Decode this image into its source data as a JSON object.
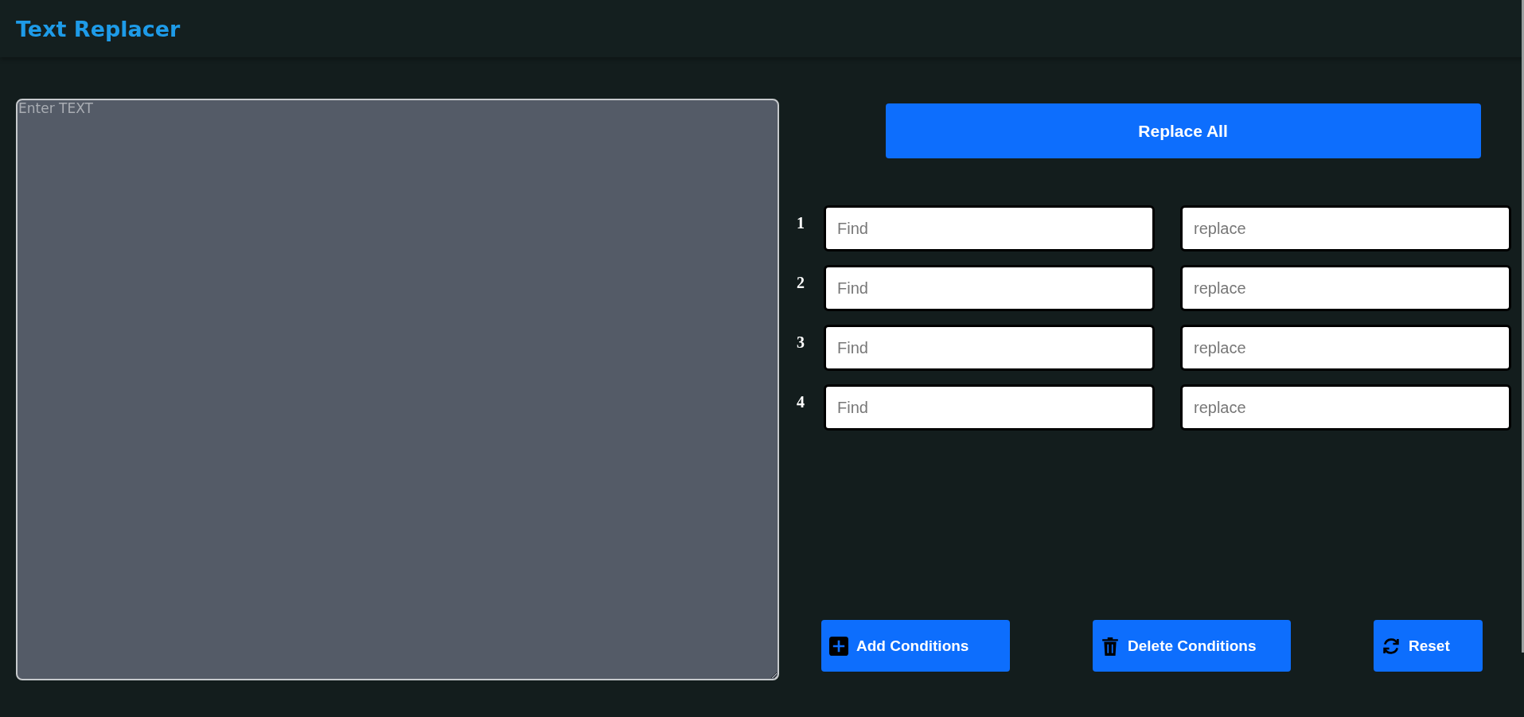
{
  "header": {
    "title": "Text Replacer"
  },
  "editor": {
    "placeholder": "Enter TEXT"
  },
  "replace_button": {
    "label": "Replace All"
  },
  "conditions": [
    {
      "number": "1",
      "find_placeholder": "Find",
      "replace_placeholder": "replace"
    },
    {
      "number": "2",
      "find_placeholder": "Find",
      "replace_placeholder": "replace"
    },
    {
      "number": "3",
      "find_placeholder": "Find",
      "replace_placeholder": "replace"
    },
    {
      "number": "4",
      "find_placeholder": "Find",
      "replace_placeholder": "replace"
    }
  ],
  "actions": [
    {
      "kind": "add",
      "label": "Add Conditions"
    },
    {
      "kind": "delete",
      "label": "Delete Conditions"
    },
    {
      "kind": "reset",
      "label": "Reset"
    }
  ]
}
